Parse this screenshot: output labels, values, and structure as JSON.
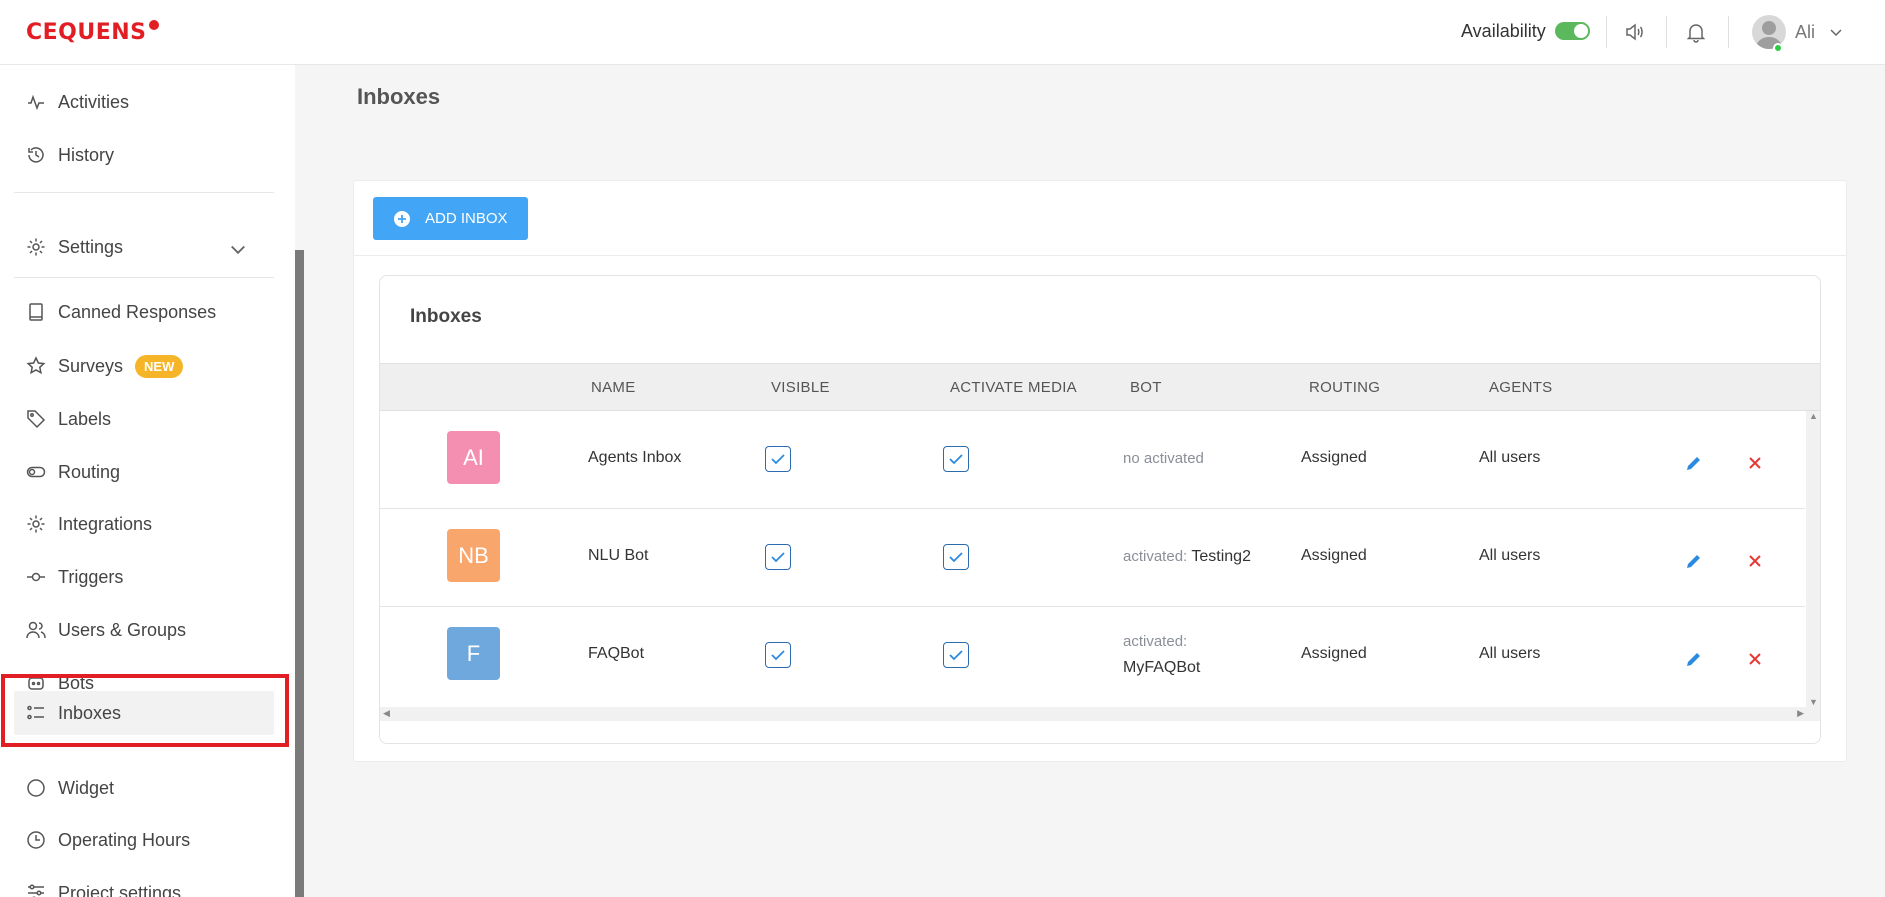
{
  "brand": {
    "logo_text": "CEQUENS",
    "color": "#e21e25"
  },
  "header": {
    "availability_label": "Availability",
    "availability_on": true,
    "user_name": "Ali"
  },
  "sidebar": {
    "items": [
      {
        "label": "Activities",
        "icon": "activity-icon"
      },
      {
        "label": "History",
        "icon": "history-icon"
      },
      {
        "label": "Settings",
        "icon": "gear-icon"
      },
      {
        "label": "Canned Responses",
        "icon": "book-icon"
      },
      {
        "label": "Surveys",
        "icon": "star-icon",
        "badge": "NEW"
      },
      {
        "label": "Labels",
        "icon": "tag-icon"
      },
      {
        "label": "Routing",
        "icon": "toggle-icon"
      },
      {
        "label": "Integrations",
        "icon": "gear-icon"
      },
      {
        "label": "Triggers",
        "icon": "trigger-icon"
      },
      {
        "label": "Users & Groups",
        "icon": "users-icon"
      },
      {
        "label": "Bots",
        "icon": "bot-icon"
      },
      {
        "label": "Inboxes",
        "icon": "list-icon",
        "active": true
      },
      {
        "label": "Widget",
        "icon": "circle-icon"
      },
      {
        "label": "Operating Hours",
        "icon": "clock-icon"
      },
      {
        "label": "Project settings",
        "icon": "sliders-icon"
      }
    ]
  },
  "page": {
    "title": "Inboxes",
    "add_button": "ADD INBOX",
    "section_title": "Inboxes"
  },
  "table": {
    "columns": [
      "NAME",
      "VISIBLE",
      "ACTIVATE MEDIA",
      "BOT",
      "ROUTING",
      "AGENTS"
    ],
    "rows": [
      {
        "initials": "AI",
        "color": "#f48fb1",
        "name": "Agents Inbox",
        "visible": true,
        "activate_media": true,
        "bot_status": "no activated",
        "bot_name": "",
        "routing": "Assigned",
        "agents": "All users"
      },
      {
        "initials": "NB",
        "color": "#f9a66c",
        "name": "NLU Bot",
        "visible": true,
        "activate_media": true,
        "bot_status": "activated:",
        "bot_name": "Testing2",
        "routing": "Assigned",
        "agents": "All users"
      },
      {
        "initials": "F",
        "color": "#6fa8dc",
        "name": "FAQBot",
        "visible": true,
        "activate_media": true,
        "bot_status": "activated:",
        "bot_name": "MyFAQBot",
        "routing": "Assigned",
        "agents": "All users"
      }
    ]
  },
  "colors": {
    "primary": "#42a5f5",
    "danger": "#e53935",
    "highlight": "#e21e25"
  }
}
